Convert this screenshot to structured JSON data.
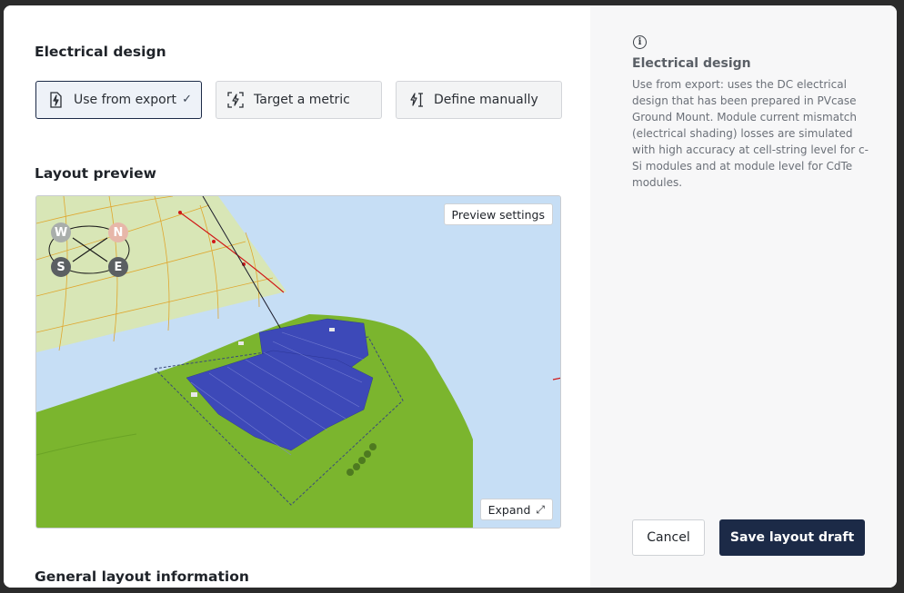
{
  "electrical": {
    "title": "Electrical design",
    "options": [
      {
        "label": "Use from export",
        "selected": true
      },
      {
        "label": "Target a metric",
        "selected": false
      },
      {
        "label": "Define manually",
        "selected": false
      }
    ]
  },
  "layout_preview": {
    "title": "Layout preview",
    "preview_settings_label": "Preview settings",
    "expand_label": "Expand",
    "compass": {
      "w": "W",
      "n": "N",
      "s": "S",
      "e": "E"
    }
  },
  "general": {
    "title": "General layout information"
  },
  "side": {
    "title": "Electrical design",
    "description": "Use from export: uses the DC electrical design that has been prepared in PVcase Ground Mount. Module current mismatch (electrical shading) losses are simulated with high accuracy at cell-string level for c-Si modules and at module level for CdTe modules."
  },
  "footer": {
    "cancel_label": "Cancel",
    "save_label": "Save layout draft"
  },
  "colors": {
    "primary": "#1c2a47",
    "terrain": "#7bb52e",
    "water": "#c6def5",
    "panels": "#3d49b8"
  }
}
